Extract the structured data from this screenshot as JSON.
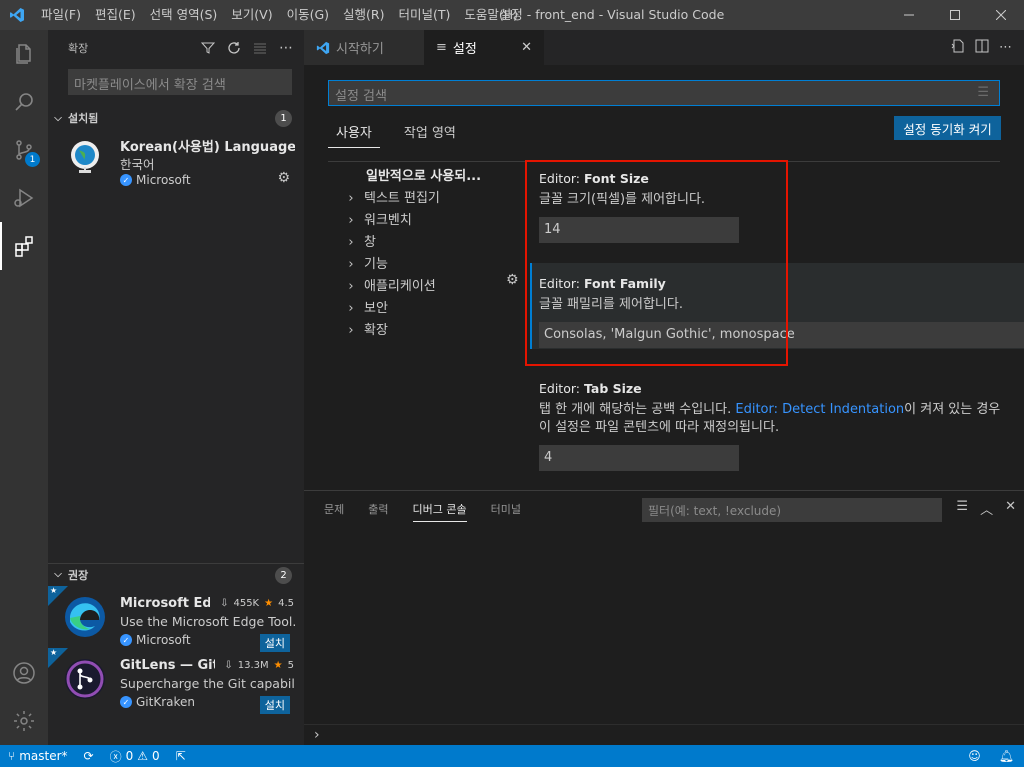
{
  "window": {
    "title": "설정 - front_end - Visual Studio Code"
  },
  "menu": [
    "파일(F)",
    "편집(E)",
    "선택 영역(S)",
    "보기(V)",
    "이동(G)",
    "실행(R)",
    "터미널(T)",
    "도움말(H)"
  ],
  "activity": {
    "scm_badge": "1"
  },
  "sidebar": {
    "title": "확장",
    "search_placeholder": "마켓플레이스에서 확장 검색",
    "installed": {
      "label": "설치됨",
      "count": "1",
      "items": [
        {
          "name": "Korean(사용법) Language ...",
          "desc": "한국어",
          "publisher": "Microsoft"
        }
      ]
    },
    "recommended": {
      "label": "권장",
      "count": "2",
      "items": [
        {
          "name": "Microsoft Ed...",
          "downloads": "455K",
          "rating": "4.5",
          "desc": "Use the Microsoft Edge Tool...",
          "publisher": "Microsoft",
          "install": "설치"
        },
        {
          "name": "GitLens — Git...",
          "downloads": "13.3M",
          "rating": "5",
          "desc": "Supercharge the Git capabili...",
          "publisher": "GitKraken",
          "install": "설치"
        }
      ]
    }
  },
  "tabs": [
    {
      "label": "시작하기"
    },
    {
      "label": "설정"
    }
  ],
  "settings": {
    "search_placeholder": "설정 검색",
    "scope_user": "사용자",
    "scope_workspace": "작업 영역",
    "sync_button": "설정 동기화 켜기",
    "toc": {
      "top": "일반적으로 사용되...",
      "items": [
        "텍스트 편집기",
        "워크벤치",
        "창",
        "기능",
        "애플리케이션",
        "보안",
        "확장"
      ]
    },
    "font_size": {
      "prefix": "Editor: ",
      "name": "Font Size",
      "desc": "글꼴 크기(픽셀)를 제어합니다.",
      "value": "14"
    },
    "font_family": {
      "prefix": "Editor: ",
      "name": "Font Family",
      "desc": "글꼴 패밀리를 제어합니다.",
      "value": "Consolas, 'Malgun Gothic', monospace"
    },
    "tab_size": {
      "prefix": "Editor: ",
      "name": "Tab Size",
      "desc_before": "탭 한 개에 해당하는 공백 수입니다. ",
      "desc_link": "Editor: Detect Indentation",
      "desc_after": "이 켜져 있는 경우 이 설정은 파일 콘텐츠에 따라 재정의됩니다.",
      "value": "4"
    }
  },
  "panel": {
    "tabs": [
      "문제",
      "출력",
      "디버그 콘솔",
      "터미널"
    ],
    "filter_placeholder": "필터(예: text, !exclude)"
  },
  "status": {
    "branch": "master*",
    "errors": "0",
    "warnings": "0"
  },
  "colors": {
    "accent": "#007acc",
    "highlight_box": "#e51400"
  }
}
